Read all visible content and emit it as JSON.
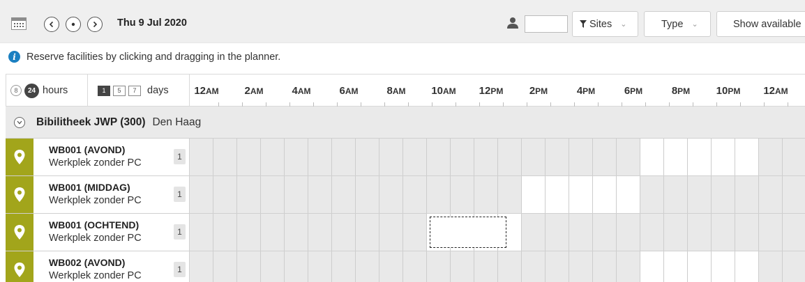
{
  "toolbar": {
    "date": "Thu 9 Jul 2020",
    "person_value": "",
    "sites_label": "Sites",
    "type_label": "Type",
    "show_available_label": "Show available"
  },
  "info": {
    "message": "Reserve facilities by clicking and dragging in the planner."
  },
  "header": {
    "hours_small": "8",
    "hours_selected": "24",
    "hours_label": "hours",
    "days_options": [
      "1",
      "5",
      "7"
    ],
    "days_selected": "1",
    "days_label": "days",
    "hour_labels": [
      {
        "num": "12",
        "ap": "AM"
      },
      {
        "num": "2",
        "ap": "AM"
      },
      {
        "num": "4",
        "ap": "AM"
      },
      {
        "num": "6",
        "ap": "AM"
      },
      {
        "num": "8",
        "ap": "AM"
      },
      {
        "num": "10",
        "ap": "AM"
      },
      {
        "num": "12",
        "ap": "PM"
      },
      {
        "num": "2",
        "ap": "PM"
      },
      {
        "num": "4",
        "ap": "PM"
      },
      {
        "num": "6",
        "ap": "PM"
      },
      {
        "num": "8",
        "ap": "PM"
      },
      {
        "num": "10",
        "ap": "PM"
      },
      {
        "num": "12",
        "ap": "AM"
      }
    ]
  },
  "group": {
    "name": "Bibilitheek JWP (300)",
    "place": "Den Haag"
  },
  "resources": [
    {
      "name": "WB001 (AVOND)",
      "type": "Werkplek zonder PC",
      "capacity": "1",
      "free_hours": [
        19,
        20,
        21,
        22,
        23
      ]
    },
    {
      "name": "WB001 (MIDDAG)",
      "type": "Werkplek zonder PC",
      "capacity": "1",
      "free_hours": [
        14,
        15,
        16,
        17,
        18
      ]
    },
    {
      "name": "WB001 (OCHTEND)",
      "type": "Werkplek zonder PC",
      "capacity": "1",
      "free_hours": [
        10,
        11,
        12,
        13
      ],
      "selected_hours": [
        10,
        13
      ]
    },
    {
      "name": "WB002 (AVOND)",
      "type": "Werkplek zonder PC",
      "capacity": "1",
      "free_hours": [
        19,
        20,
        21,
        22,
        23
      ]
    }
  ]
}
